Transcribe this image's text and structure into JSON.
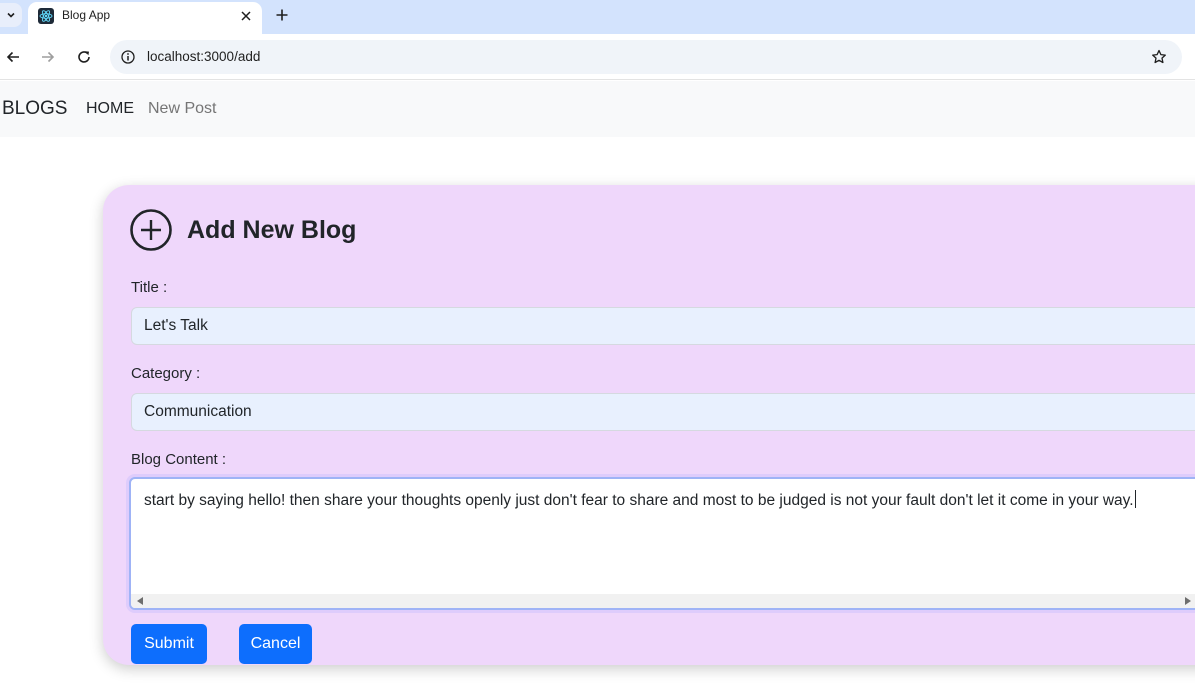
{
  "browser": {
    "tab_title": "Blog App",
    "tab_close_glyph": "✕",
    "new_tab_glyph": "+",
    "tab_menu_glyph": "⌄",
    "url": "localhost:3000/add",
    "icons": [
      "tab-menu-icon",
      "react-logo-icon",
      "close-icon",
      "plus-icon",
      "back-arrow-icon",
      "forward-arrow-icon",
      "reload-icon",
      "site-info-icon",
      "bookmark-star-icon"
    ]
  },
  "navbar": {
    "brand": "BLOGS",
    "links": [
      {
        "label": "HOME"
      },
      {
        "label": "New Post"
      }
    ]
  },
  "form": {
    "heading": "Add New Blog",
    "heading_icon": "add-circle-icon",
    "title_label": "Title :",
    "title_value": "Let's Talk",
    "category_label": "Category :",
    "category_value": "Communication",
    "content_label": "Blog Content :",
    "content_value": "start by saying hello! then share your thoughts openly just don't fear to share and most to be judged is not your fault don't let it come in your way.",
    "submit_label": "Submit",
    "cancel_label": "Cancel"
  },
  "colors": {
    "tabstrip": "#d3e3fd",
    "navbar_bg": "#f8f9fa",
    "card_bg": "#efd7fb",
    "input_bg": "#e8f0fe",
    "button_primary": "#0d6efd",
    "focus_ring": "#9fb3f6"
  }
}
